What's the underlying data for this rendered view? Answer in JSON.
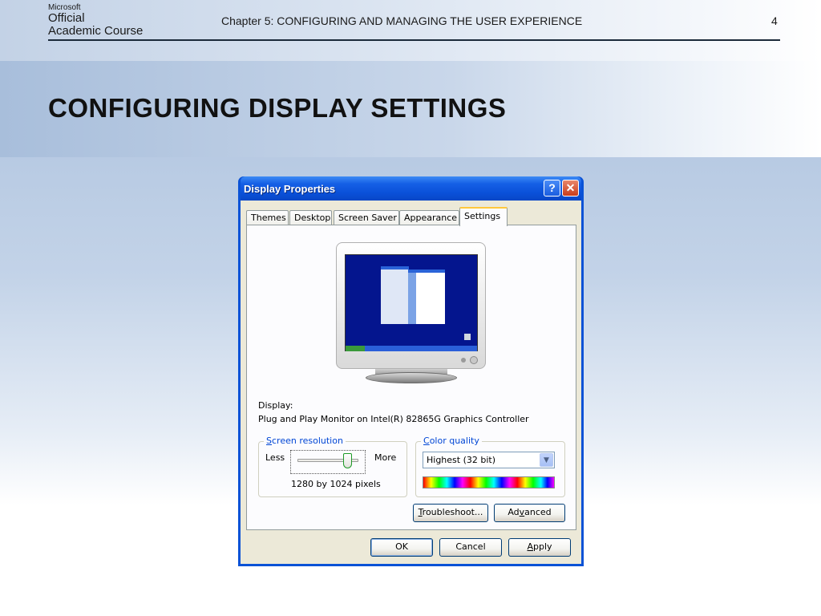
{
  "slide": {
    "logo_brand": "Microsoft",
    "logo_line1": "Official",
    "logo_line2": "Academic Course",
    "chapter": "Chapter 5: CONFIGURING AND MANAGING THE USER EXPERIENCE",
    "page_number": "4",
    "title": "CONFIGURING DISPLAY SETTINGS"
  },
  "window": {
    "title": "Display Properties",
    "help_button": "?",
    "close_button": "✕",
    "tabs": [
      {
        "label": "Themes"
      },
      {
        "label": "Desktop"
      },
      {
        "label": "Screen Saver"
      },
      {
        "label": "Appearance"
      },
      {
        "label": "Settings",
        "active": true
      }
    ]
  },
  "settings": {
    "display_label": "Display:",
    "display_value": "Plug and Play Monitor on Intel(R) 82865G Graphics Controller",
    "screen_resolution": {
      "legend_accesskey": "S",
      "legend_rest": "creen resolution",
      "less_label": "Less",
      "more_label": "More",
      "slider_position": 0.88,
      "value": "1280 by 1024 pixels"
    },
    "color_quality": {
      "legend_accesskey": "C",
      "legend_rest": "olor quality",
      "selected": "Highest (32 bit)"
    },
    "troubleshoot_button": {
      "accesskey": "T",
      "rest": "roubleshoot..."
    },
    "advanced_button": {
      "before": "Ad",
      "accesskey": "v",
      "after": "anced"
    }
  },
  "footer_buttons": {
    "ok": "OK",
    "cancel": "Cancel",
    "apply_accesskey": "A",
    "apply_rest": "pply"
  },
  "colors": {
    "titlebar": "#0a50d8",
    "dialog_bg": "#ece9d8",
    "active_tab_accent": "#ffc83c",
    "groupbox_legend": "#0046d5"
  }
}
